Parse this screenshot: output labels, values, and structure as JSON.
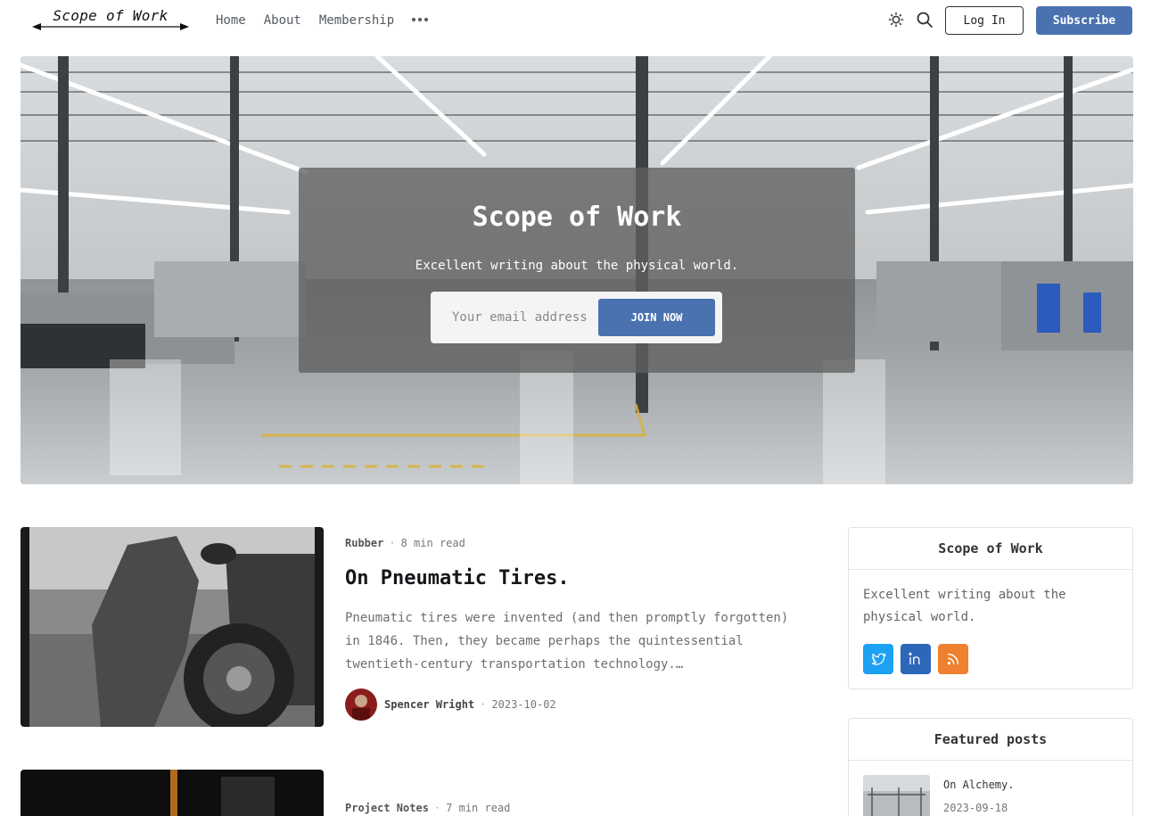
{
  "header": {
    "logo_text": "Scope of Work",
    "nav": [
      "Home",
      "About",
      "Membership"
    ],
    "login_label": "Log In",
    "subscribe_label": "Subscribe"
  },
  "hero": {
    "title": "Scope of Work",
    "description": "Excellent writing about the physical world.",
    "email_placeholder": "Your email address",
    "join_label": "JOIN NOW"
  },
  "posts": [
    {
      "tag": "Rubber",
      "read_time": "8 min read",
      "title": "On Pneumatic Tires.",
      "excerpt": "Pneumatic tires were invented (and then promptly forgotten) in 1846. Then, they became perhaps the quintessential twentieth-century transportation technology.…",
      "author": "Spencer Wright",
      "date": "2023-10-02"
    },
    {
      "tag": "Project Notes",
      "read_time": "7 min read"
    }
  ],
  "sidebar": {
    "about": {
      "title": "Scope of Work",
      "description": "Excellent writing about the physical world.",
      "social": [
        {
          "name": "twitter-icon",
          "color": "#1da1f2"
        },
        {
          "name": "linkedin-icon",
          "color": "#2c67ba"
        },
        {
          "name": "rss-icon",
          "color": "#ee802f"
        }
      ]
    },
    "featured": {
      "title": "Featured posts",
      "items": [
        {
          "title": "On Alchemy.",
          "date": "2023-09-18"
        }
      ]
    }
  },
  "colors": {
    "accent": "#4a72b0"
  }
}
